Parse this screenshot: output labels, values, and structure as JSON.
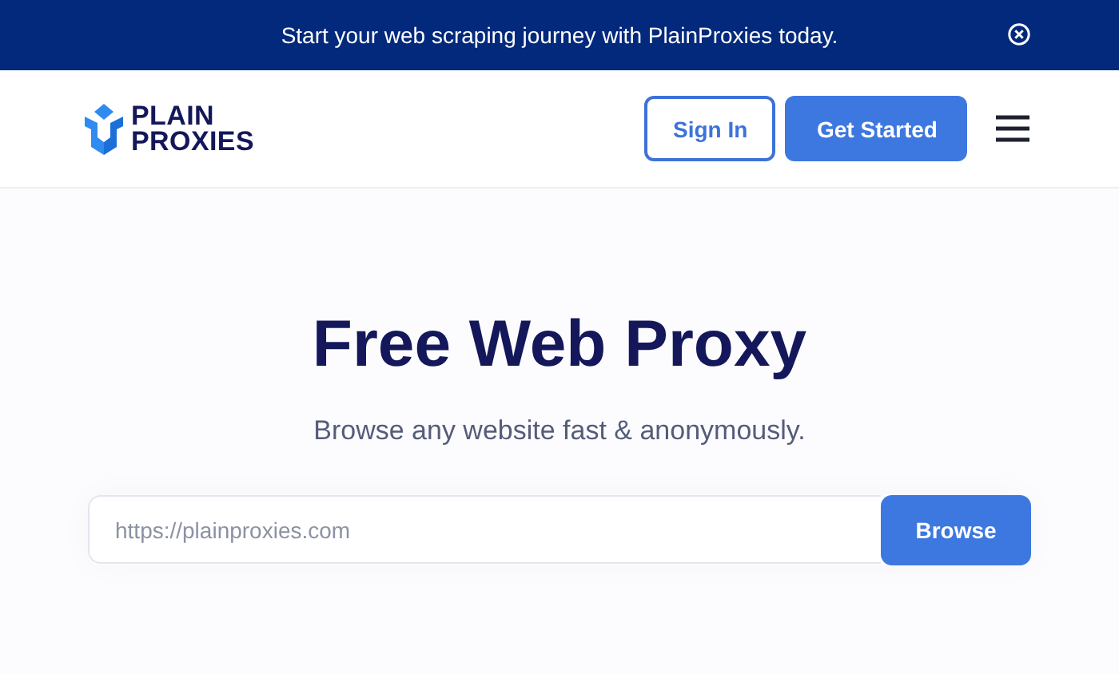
{
  "banner": {
    "text": "Start your web scraping journey with PlainProxies today."
  },
  "header": {
    "logo": {
      "lines": [
        "PLAIN",
        "PROXIES"
      ]
    },
    "buttons": [
      {
        "label": "Sign In",
        "kind": "outline"
      },
      {
        "label": "Get Started",
        "kind": "primary"
      }
    ]
  },
  "hero": {
    "title": "Free Web Proxy",
    "subtitle": "Browse any website fast & anonymously.",
    "search": {
      "placeholder": "https://plainproxies.com",
      "button": "Browse"
    }
  }
}
